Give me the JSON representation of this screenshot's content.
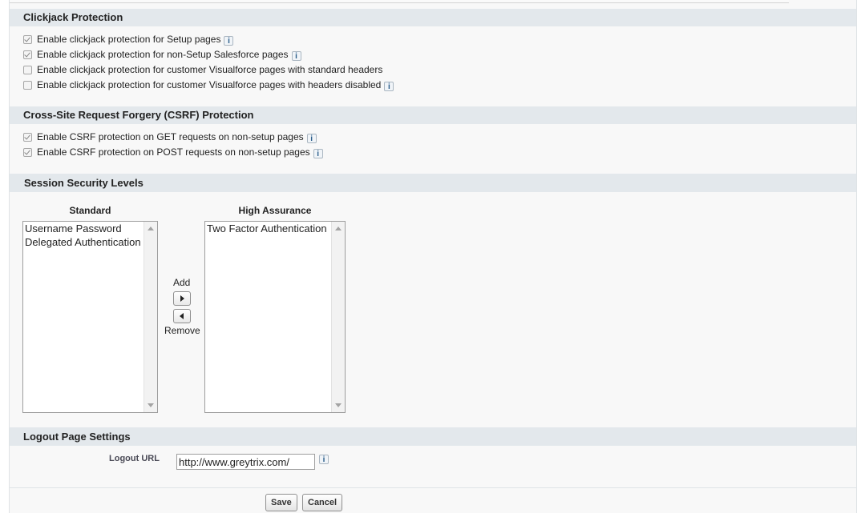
{
  "clickjack": {
    "title": "Clickjack Protection",
    "options": [
      {
        "label": "Enable clickjack protection for Setup pages",
        "checked": true
      },
      {
        "label": "Enable clickjack protection for non-Setup Salesforce pages",
        "checked": true
      },
      {
        "label": "Enable clickjack protection for customer Visualforce pages with standard headers",
        "checked": false
      },
      {
        "label": "Enable clickjack protection for customer Visualforce pages with headers disabled",
        "checked": false
      }
    ]
  },
  "csrf": {
    "title": "Cross-Site Request Forgery (CSRF) Protection",
    "options": [
      {
        "label": "Enable CSRF protection on GET requests on non-setup pages",
        "checked": true
      },
      {
        "label": "Enable CSRF protection on POST requests on non-setup pages",
        "checked": true
      }
    ]
  },
  "session_levels": {
    "title": "Session Security Levels",
    "standard_label": "Standard",
    "standard_items": [
      "Username Password",
      "Delegated Authentication"
    ],
    "high_label": "High Assurance",
    "high_items": [
      "Two Factor Authentication"
    ],
    "add_label": "Add",
    "remove_label": "Remove"
  },
  "logout": {
    "title": "Logout Page Settings",
    "url_label": "Logout URL",
    "url_value": "http://www.greytrix.com/"
  },
  "buttons": {
    "save": "Save",
    "cancel": "Cancel"
  },
  "icons": {
    "info": "info-icon",
    "checkbox": "checkbox-icon",
    "add_arrow": "arrow-right-icon",
    "remove_arrow": "arrow-left-icon"
  }
}
